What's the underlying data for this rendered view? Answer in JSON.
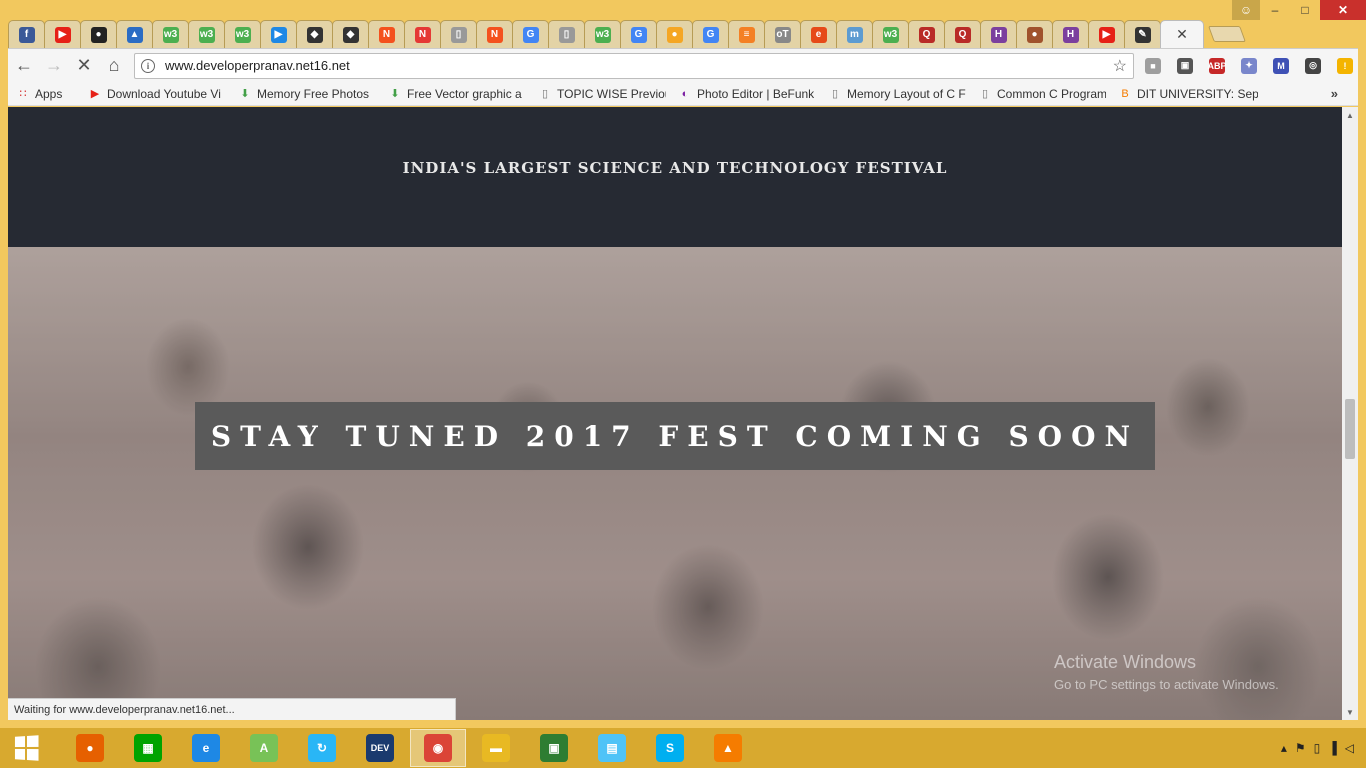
{
  "window": {
    "controls": {
      "user": "☺",
      "minimize": "–",
      "maximize": "□",
      "close": "✕"
    }
  },
  "tabs": [
    {
      "icon": "facebook-icon",
      "glyph": "f",
      "color": "#3b5998"
    },
    {
      "icon": "youtube-icon",
      "glyph": "▶",
      "color": "#e62117"
    },
    {
      "icon": "github-icon",
      "glyph": "●",
      "color": "#222"
    },
    {
      "icon": "blue-tag-icon",
      "glyph": "▲",
      "color": "#2b6cc4"
    },
    {
      "icon": "w3-icon",
      "glyph": "w3",
      "color": "#4caf50"
    },
    {
      "icon": "w3-icon",
      "glyph": "w3",
      "color": "#4caf50"
    },
    {
      "icon": "w3-icon",
      "glyph": "w3",
      "color": "#4caf50"
    },
    {
      "icon": "play-circle-icon",
      "glyph": "▶",
      "color": "#1e88e5"
    },
    {
      "icon": "fox-icon",
      "glyph": "◆",
      "color": "#333"
    },
    {
      "icon": "fox-icon",
      "glyph": "◆",
      "color": "#333"
    },
    {
      "icon": "n-icon",
      "glyph": "N",
      "color": "#f4511e"
    },
    {
      "icon": "n-icon",
      "glyph": "N",
      "color": "#e53935"
    },
    {
      "icon": "page-icon",
      "glyph": "▯",
      "color": "#999"
    },
    {
      "icon": "n-icon",
      "glyph": "N",
      "color": "#f4511e"
    },
    {
      "icon": "google-icon",
      "glyph": "G",
      "color": "#4285f4"
    },
    {
      "icon": "page-icon",
      "glyph": "▯",
      "color": "#999"
    },
    {
      "icon": "w3-icon",
      "glyph": "w3",
      "color": "#4caf50"
    },
    {
      "icon": "google-icon",
      "glyph": "G",
      "color": "#4285f4"
    },
    {
      "icon": "orange-circle-icon",
      "glyph": "●",
      "color": "#f5a623"
    },
    {
      "icon": "google-icon",
      "glyph": "G",
      "color": "#4285f4"
    },
    {
      "icon": "stack-icon",
      "glyph": "≡",
      "color": "#f48024"
    },
    {
      "icon": "ott-icon",
      "glyph": "oT",
      "color": "#888"
    },
    {
      "icon": "swirl-icon",
      "glyph": "e",
      "color": "#e64a19"
    },
    {
      "icon": "m-icon",
      "glyph": "m",
      "color": "#5c9bd1"
    },
    {
      "icon": "w3-icon",
      "glyph": "w3",
      "color": "#4caf50"
    },
    {
      "icon": "quora-icon",
      "glyph": "Q",
      "color": "#b92b27"
    },
    {
      "icon": "quora-icon",
      "glyph": "Q",
      "color": "#b92b27"
    },
    {
      "icon": "h-icon",
      "glyph": "H",
      "color": "#7b3f9e"
    },
    {
      "icon": "owl-icon",
      "glyph": "●",
      "color": "#a0522d"
    },
    {
      "icon": "h-icon",
      "glyph": "H",
      "color": "#7b3f9e"
    },
    {
      "icon": "youtube-icon",
      "glyph": "▶",
      "color": "#e62117"
    },
    {
      "icon": "pencil-icon",
      "glyph": "✎",
      "color": "#333"
    }
  ],
  "active_tab": {
    "close": "✕"
  },
  "toolbar": {
    "back": "←",
    "forward": "→",
    "stop": "✕",
    "home": "⌂",
    "url": "www.developerpranav.net16.net",
    "info": "i",
    "star": "☆"
  },
  "extensions": [
    {
      "icon": "grey-square-icon",
      "glyph": "■",
      "color": "#9e9e9e"
    },
    {
      "icon": "briefcase-icon",
      "glyph": "▣",
      "color": "#555"
    },
    {
      "icon": "adblock-icon",
      "glyph": "ABP",
      "color": "#c62828"
    },
    {
      "icon": "puzzle-icon",
      "glyph": "✦",
      "color": "#7986cb"
    },
    {
      "icon": "gmail-icon",
      "glyph": "M",
      "color": "#3f51b5"
    },
    {
      "icon": "globe-icon",
      "glyph": "◎",
      "color": "#444"
    },
    {
      "icon": "warning-icon",
      "glyph": "!",
      "color": "#f4b400"
    }
  ],
  "bookmarks": [
    {
      "icon": "apps-icon",
      "glyph": "∷",
      "color": "#d32f2f",
      "label": "Apps",
      "width": 60
    },
    {
      "icon": "youtube-icon",
      "glyph": "▶",
      "color": "#e62117",
      "label": "Download Youtube Vi",
      "width": 138
    },
    {
      "icon": "download-arrow-icon",
      "glyph": "⬇",
      "color": "#43a047",
      "label": "Memory Free Photos",
      "width": 138
    },
    {
      "icon": "download-arrow-icon",
      "glyph": "⬇",
      "color": "#43a047",
      "label": "Free Vector graphic a",
      "width": 138
    },
    {
      "icon": "page-icon",
      "glyph": "▯",
      "color": "#777",
      "label": "TOPIC WISE Previous",
      "width": 128
    },
    {
      "icon": "befunky-icon",
      "glyph": "◐",
      "color": "#7b1fa2",
      "label": "Photo Editor | BeFunk",
      "width": 138
    },
    {
      "icon": "page-icon",
      "glyph": "▯",
      "color": "#777",
      "label": "Memory Layout of C F",
      "width": 138
    },
    {
      "icon": "page-icon",
      "glyph": "▯",
      "color": "#777",
      "label": "Common C Programn",
      "width": 128
    },
    {
      "icon": "blogger-icon",
      "glyph": "B",
      "color": "#f57c00",
      "label": "DIT UNIVERSITY: Sept",
      "width": 140
    }
  ],
  "bookmarks_more": "»",
  "page": {
    "tagline": "INDIA'S LARGEST SCIENCE AND TECHNOLOGY FESTIVAL",
    "banner": "STAY TUNED 2017 FEST COMING SOON"
  },
  "watermark": {
    "line1": "Activate Windows",
    "line2": "Go to PC settings to activate Windows."
  },
  "status": "Waiting for www.developerpranav.net16.net...",
  "taskbar": {
    "apps": [
      {
        "name": "firefox-icon",
        "glyph": "●",
        "color": "#e66000"
      },
      {
        "name": "store-icon",
        "glyph": "▦",
        "color": "#00a300"
      },
      {
        "name": "internet-explorer-icon",
        "glyph": "e",
        "color": "#1e88e5"
      },
      {
        "name": "android-studio-icon",
        "glyph": "A",
        "color": "#78c257"
      },
      {
        "name": "sync-icon",
        "glyph": "↻",
        "color": "#29b6f6"
      },
      {
        "name": "dev-cpp-icon",
        "glyph": "DEV",
        "color": "#1a3a6e"
      },
      {
        "name": "chrome-icon",
        "glyph": "◉",
        "color": "#db4437"
      },
      {
        "name": "file-explorer-icon",
        "glyph": "▬",
        "color": "#e8b923"
      },
      {
        "name": "photos-icon",
        "glyph": "▣",
        "color": "#2e7d32"
      },
      {
        "name": "notepad-icon",
        "glyph": "▤",
        "color": "#4fc3f7"
      },
      {
        "name": "skype-icon",
        "glyph": "S",
        "color": "#00aff0"
      },
      {
        "name": "vlc-icon",
        "glyph": "▲",
        "color": "#f57c00"
      }
    ],
    "active_index": 6,
    "tray": {
      "caret": "▴",
      "flag": "⚑",
      "battery": "▯",
      "signal": "▐",
      "volume": "◁"
    }
  }
}
